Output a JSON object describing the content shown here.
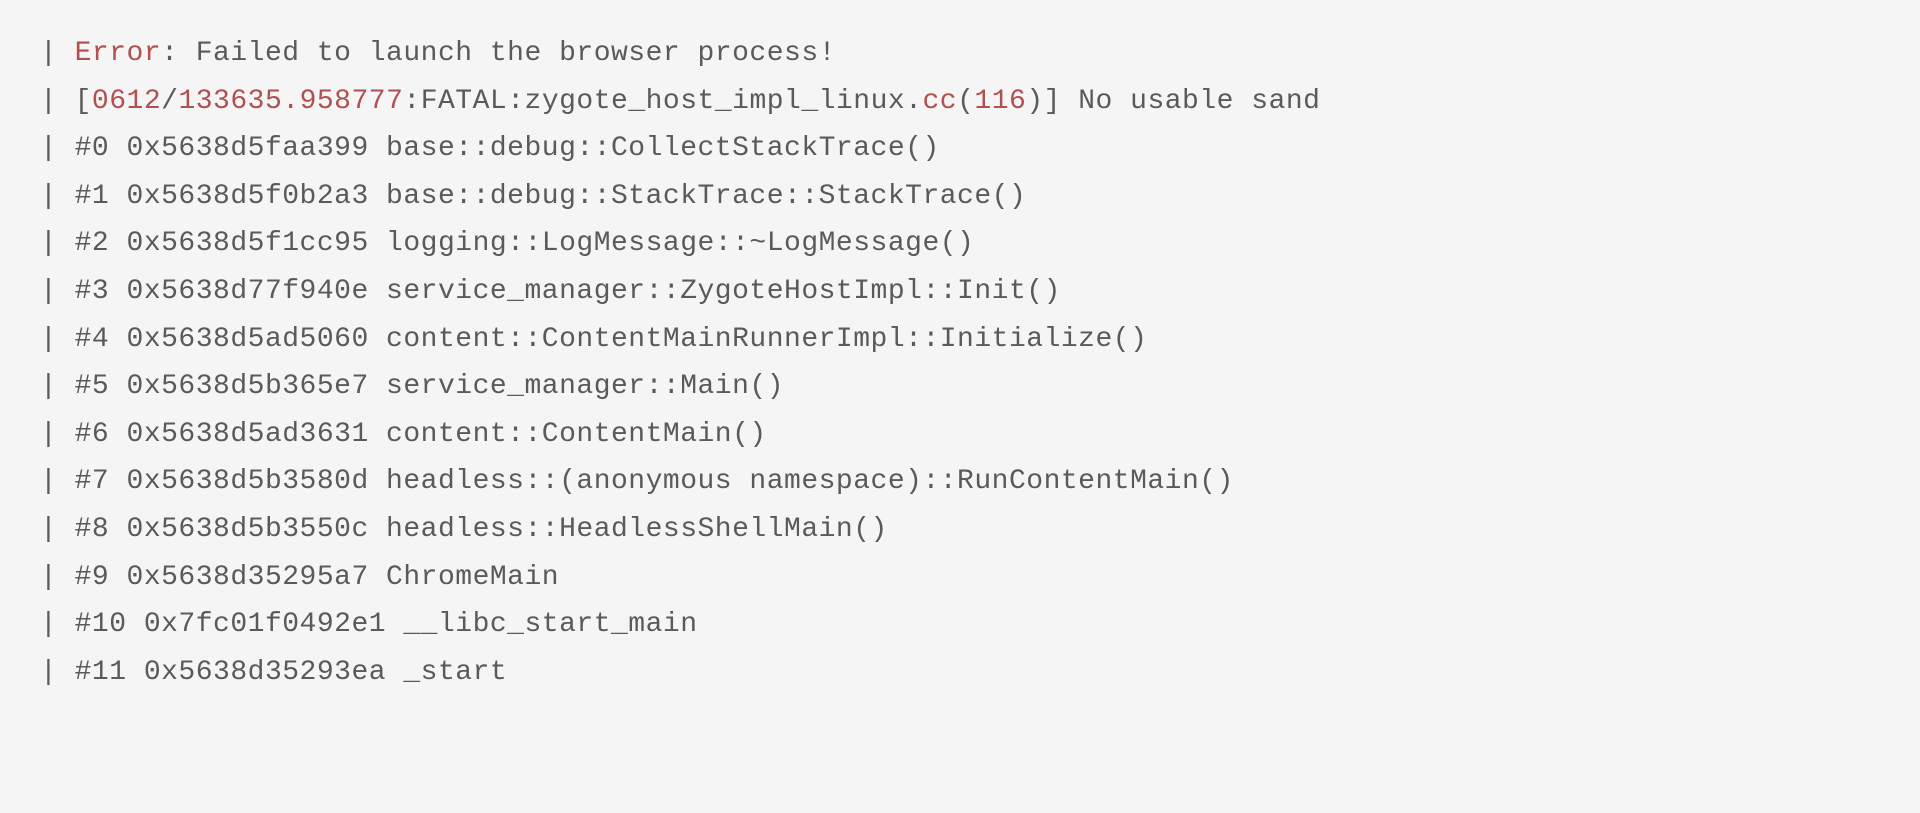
{
  "lines": [
    {
      "prefix": "| ",
      "segments": [
        {
          "text": "Error",
          "class": "error"
        },
        {
          "text": ": Failed to launch the browser process!",
          "class": "text"
        }
      ]
    },
    {
      "prefix": "| ",
      "segments": [
        {
          "text": "[",
          "class": "text"
        },
        {
          "text": "0612",
          "class": "num"
        },
        {
          "text": "/",
          "class": "text"
        },
        {
          "text": "133635.958777",
          "class": "num"
        },
        {
          "text": ":FATAL:zygote_host_impl_linux.",
          "class": "text"
        },
        {
          "text": "cc",
          "class": "error"
        },
        {
          "text": "(",
          "class": "text"
        },
        {
          "text": "116",
          "class": "num"
        },
        {
          "text": ")] No usable sand",
          "class": "text"
        }
      ]
    },
    {
      "prefix": "| ",
      "segments": [
        {
          "text": "#0 0x5638d5faa399 base::debug::CollectStackTrace()",
          "class": "text"
        }
      ]
    },
    {
      "prefix": "| ",
      "segments": [
        {
          "text": "#1 0x5638d5f0b2a3 base::debug::StackTrace::StackTrace()",
          "class": "text"
        }
      ]
    },
    {
      "prefix": "| ",
      "segments": [
        {
          "text": "#2 0x5638d5f1cc95 logging::LogMessage::~LogMessage()",
          "class": "text"
        }
      ]
    },
    {
      "prefix": "| ",
      "segments": [
        {
          "text": "#3 0x5638d77f940e service_manager::ZygoteHostImpl::Init()",
          "class": "text"
        }
      ]
    },
    {
      "prefix": "| ",
      "segments": [
        {
          "text": "#4 0x5638d5ad5060 content::ContentMainRunnerImpl::Initialize()",
          "class": "text"
        }
      ]
    },
    {
      "prefix": "| ",
      "segments": [
        {
          "text": "#5 0x5638d5b365e7 service_manager::Main()",
          "class": "text"
        }
      ]
    },
    {
      "prefix": "| ",
      "segments": [
        {
          "text": "#6 0x5638d5ad3631 content::ContentMain()",
          "class": "text"
        }
      ]
    },
    {
      "prefix": "| ",
      "segments": [
        {
          "text": "#7 0x5638d5b3580d headless::(anonymous namespace)::RunContentMain()",
          "class": "text"
        }
      ]
    },
    {
      "prefix": "| ",
      "segments": [
        {
          "text": "#8 0x5638d5b3550c headless::HeadlessShellMain()",
          "class": "text"
        }
      ]
    },
    {
      "prefix": "| ",
      "segments": [
        {
          "text": "#9 0x5638d35295a7 ChromeMain",
          "class": "text"
        }
      ]
    },
    {
      "prefix": "| ",
      "segments": [
        {
          "text": "#10 0x7fc01f0492e1 __libc_start_main",
          "class": "text"
        }
      ]
    },
    {
      "prefix": "| ",
      "segments": [
        {
          "text": "#11 0x5638d35293ea _start",
          "class": "text"
        }
      ]
    }
  ]
}
